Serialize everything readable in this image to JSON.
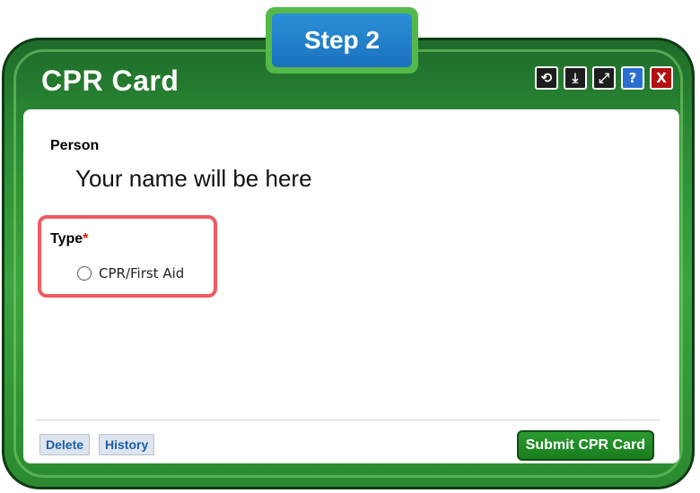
{
  "step_badge": {
    "label": "Step 2"
  },
  "window": {
    "title": "CPR Card",
    "toolbar": {
      "buttons": [
        {
          "name": "refresh-icon",
          "glyph": "⟲"
        },
        {
          "name": "download-icon",
          "glyph": "⤓"
        },
        {
          "name": "expand-icon",
          "glyph": "⤢"
        },
        {
          "name": "help-icon",
          "glyph": "?"
        },
        {
          "name": "close-icon",
          "glyph": "X"
        }
      ]
    }
  },
  "form": {
    "person_label": "Person",
    "person_value": "Your name will be here",
    "type_label": "Type",
    "required_marker": "*",
    "type_options": [
      {
        "label": "CPR/First Aid",
        "selected": false
      }
    ]
  },
  "footer": {
    "delete_label": "Delete",
    "history_label": "History",
    "submit_label": "Submit CPR Card"
  },
  "colors": {
    "frame_green": "#2a8a34",
    "badge_blue": "#1b72bf",
    "highlight_red": "#ef5a63",
    "submit_green": "#1a7d1f"
  }
}
